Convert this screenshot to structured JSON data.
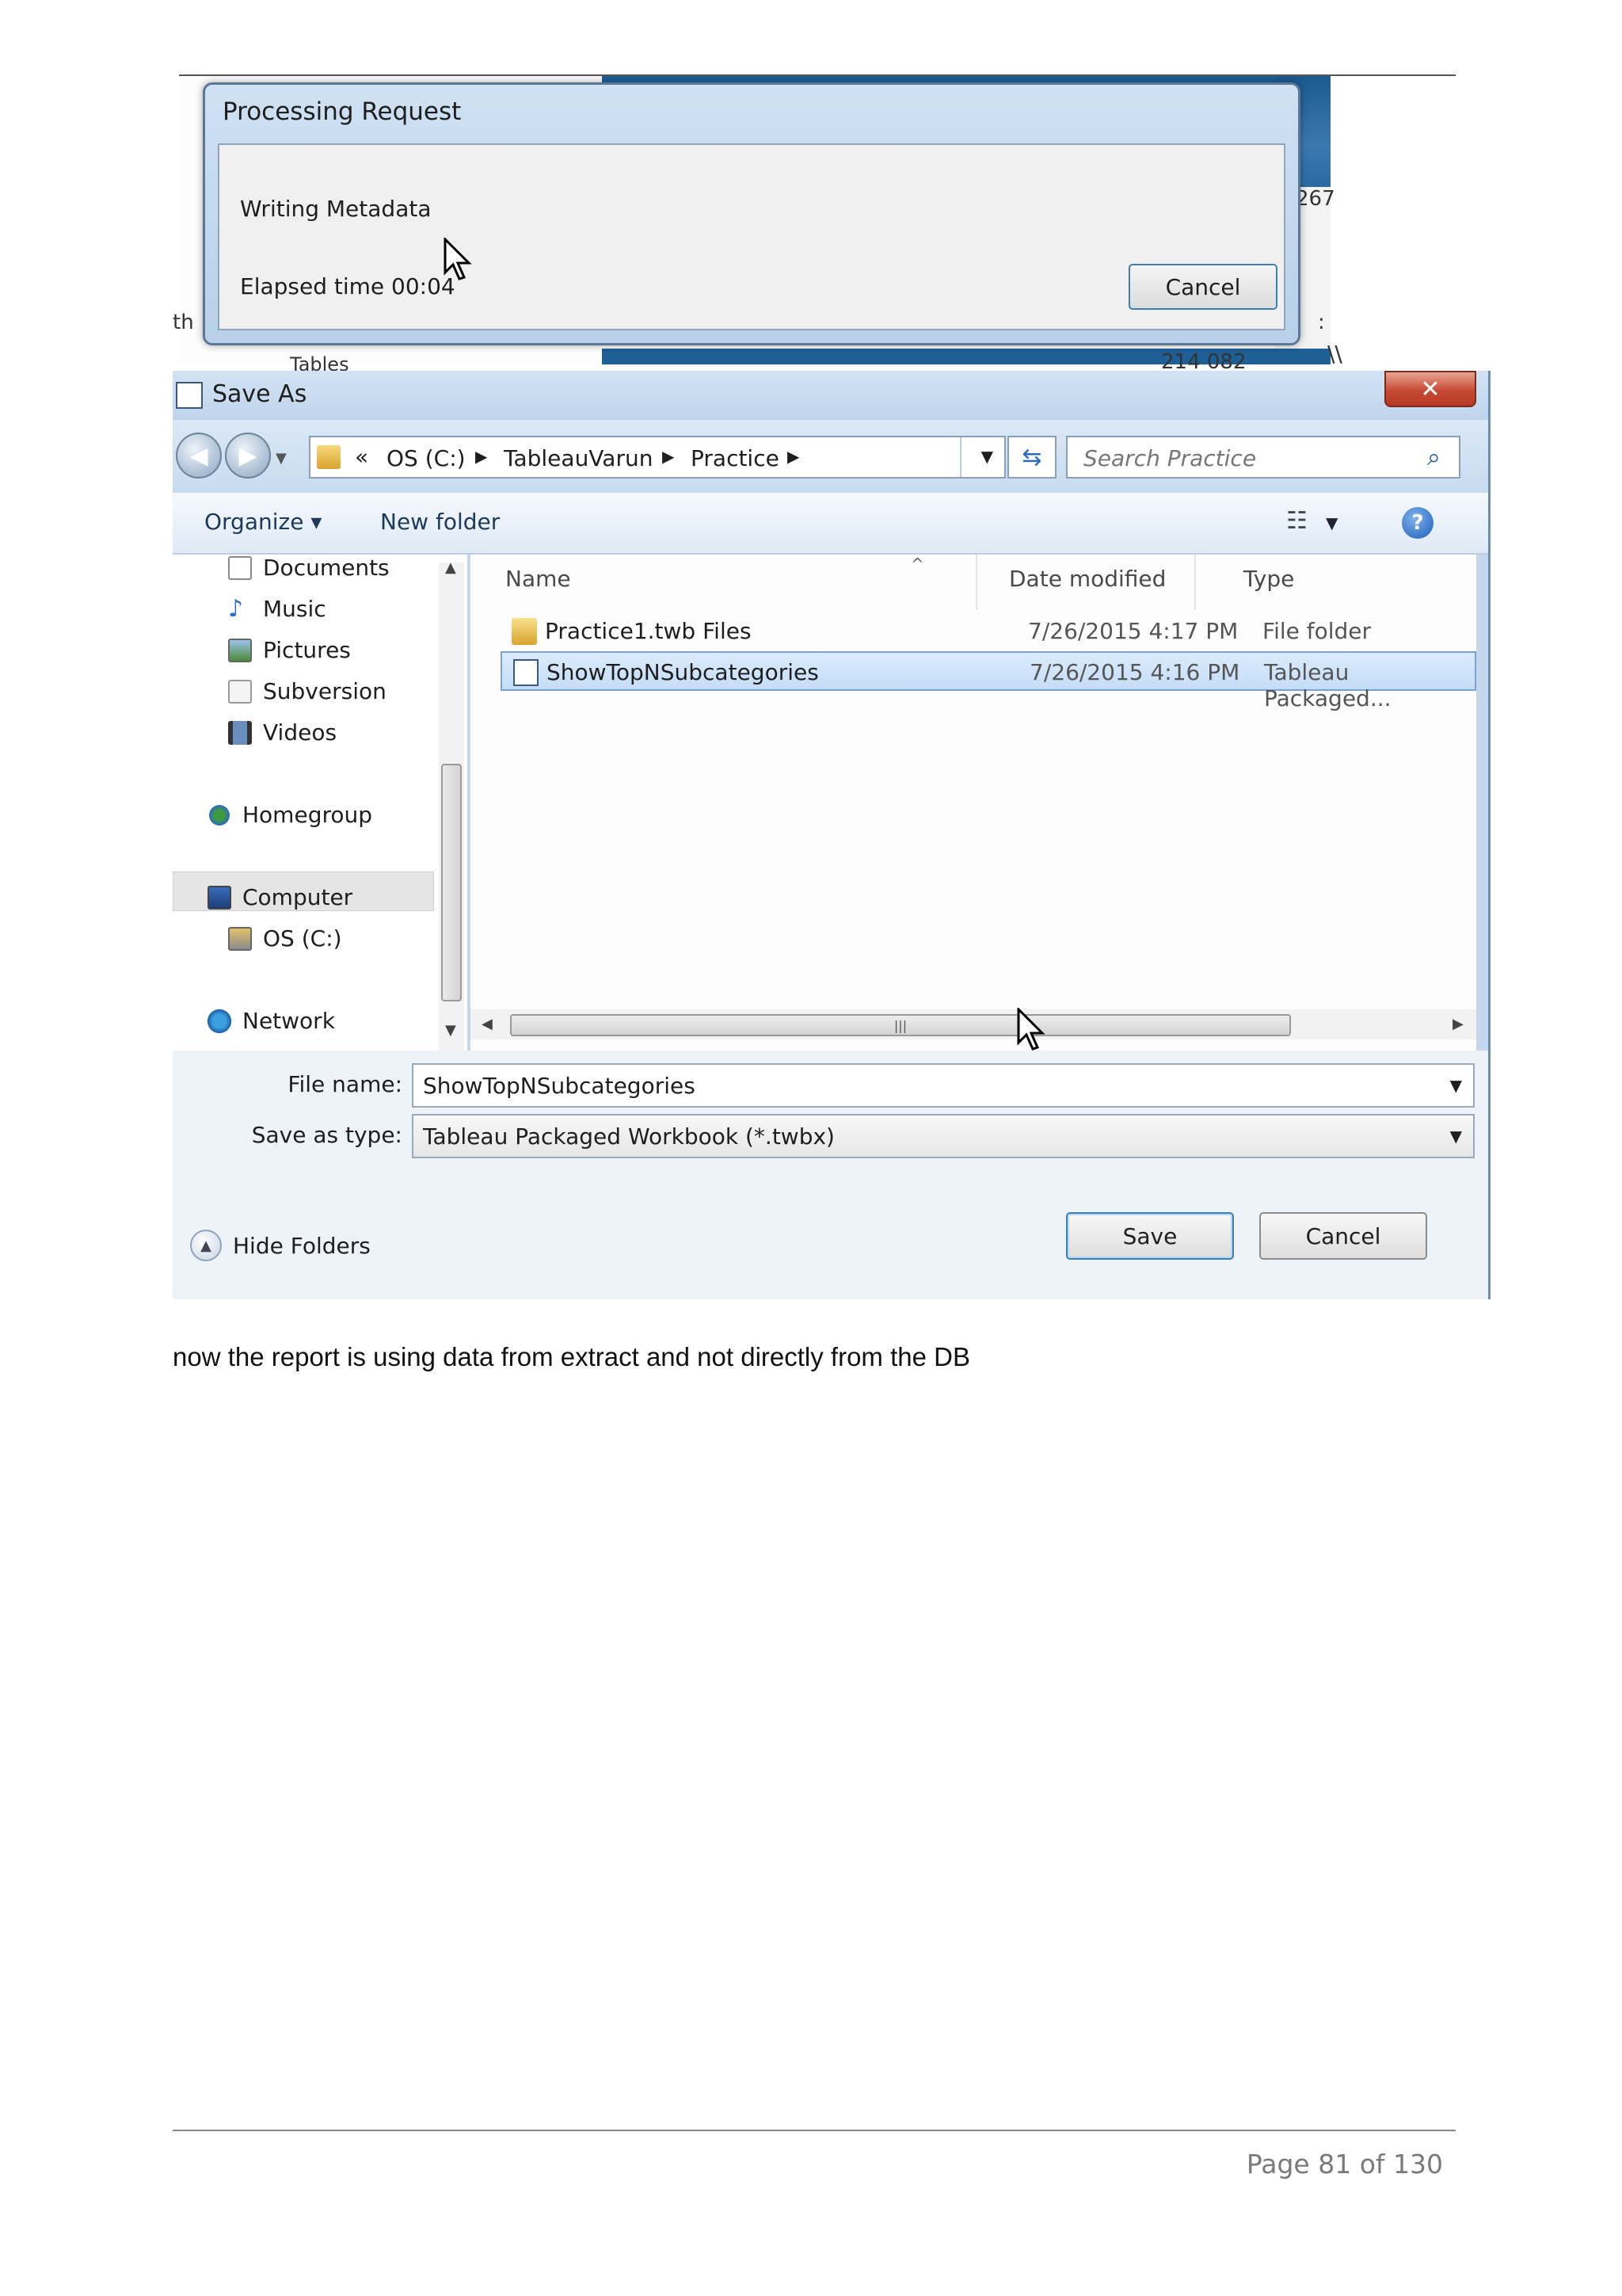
{
  "processing_dialog": {
    "title": "Processing Request",
    "status": "Writing Metadata",
    "elapsed": "Elapsed time 00:04",
    "cancel_label": "Cancel"
  },
  "background_fragments": {
    "num_right": "267",
    "num_bottom": "214 082",
    "left_text": "th",
    "tables": "Tables",
    "colon": ":",
    "slash": "\\\\"
  },
  "save_dialog": {
    "title": "Save As",
    "close_label": "✕",
    "breadcrumb": [
      "OS (C:)",
      "TableauVarun",
      "Practice"
    ],
    "search_placeholder": "Search Practice",
    "organize_label": "Organize ▾",
    "new_folder_label": "New folder",
    "nav_items": [
      {
        "label": "Documents",
        "icon": "documents-icon"
      },
      {
        "label": "Music",
        "icon": "music-icon"
      },
      {
        "label": "Pictures",
        "icon": "pictures-icon"
      },
      {
        "label": "Subversion",
        "icon": "subversion-icon"
      },
      {
        "label": "Videos",
        "icon": "videos-icon"
      },
      {
        "label": "Homegroup",
        "icon": "homegroup-icon"
      },
      {
        "label": "Computer",
        "icon": "computer-icon"
      },
      {
        "label": "OS (C:)",
        "icon": "drive-icon"
      },
      {
        "label": "Network",
        "icon": "network-icon"
      }
    ],
    "columns": {
      "name": "Name",
      "date": "Date modified",
      "type": "Type"
    },
    "files": [
      {
        "name": "Practice1.twb Files",
        "date": "7/26/2015 4:17 PM",
        "type": "File folder",
        "icon": "folder-icon"
      },
      {
        "name": "ShowTopNSubcategories",
        "date": "7/26/2015 4:16 PM",
        "type": "Tableau Packaged...",
        "icon": "tableau-file-icon",
        "selected": true
      }
    ],
    "file_name_label": "File name:",
    "file_name_value": "ShowTopNSubcategories",
    "save_type_label": "Save as type:",
    "save_type_value": "Tableau Packaged Workbook (*.twbx)",
    "hide_folders_label": "Hide Folders",
    "save_label": "Save",
    "cancel_label": "Cancel"
  },
  "caption": "now the report is using data from extract and not directly from the DB",
  "page_number": "Page 81 of 130"
}
